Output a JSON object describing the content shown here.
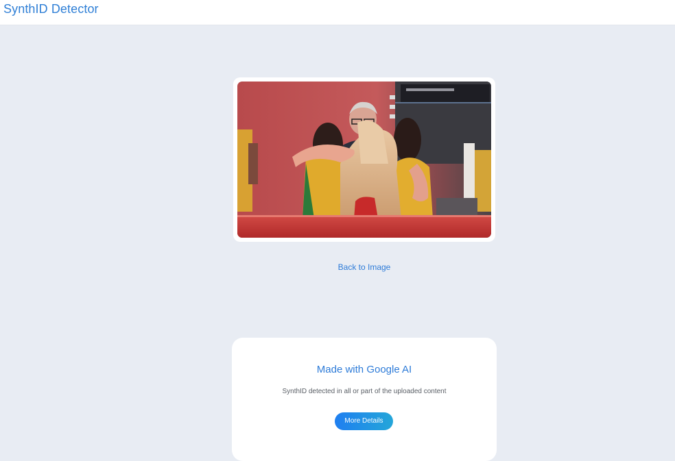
{
  "header": {
    "app_title": "SynthID Detector"
  },
  "preview": {
    "image_alt": "Uploaded photo: people embracing in a red-lit room"
  },
  "back_link": "Back to Image",
  "result": {
    "title": "Made with Google AI",
    "description": "SynthID detected in all or part of the uploaded content",
    "button_label": "More Details"
  },
  "colors": {
    "accent": "#2d7bd8",
    "page_bg": "#e8ecf3",
    "button_gradient_start": "#1f7ff0",
    "button_gradient_end": "#24a6d9"
  }
}
